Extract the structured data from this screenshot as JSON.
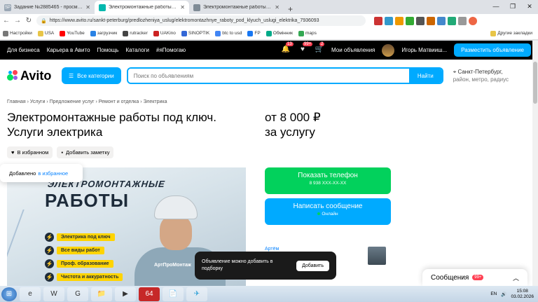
{
  "browser": {
    "tabs": [
      {
        "label": "Задание №2885465 - просмотр з",
        "favicon_color": "#9aa7b5",
        "favicon_text": "SP",
        "active": false
      },
      {
        "label": "Электромонтажные работы под",
        "favicon_color": "#04b8ae",
        "active": true
      },
      {
        "label": "Электромонтажные работы под",
        "favicon_color": "#7f8b96",
        "active": false
      }
    ],
    "new_tab": "+",
    "window_controls": [
      "—",
      "❐",
      "✕"
    ],
    "url": "https://www.avito.ru/sankt-peterburg/predlozheniya_uslug/elektromontazhnye_raboty_pod_klyuch_uslugi_elektrika_7936093",
    "bookmarks": [
      "Настройки",
      "USA",
      "YouTube",
      "загрузчик",
      "rutracker",
      "UAKino",
      "SINOPTIK",
      "btc to usd",
      "FP",
      "Обмінник",
      "maps",
      "Другие закладки"
    ]
  },
  "avito": {
    "topnav": [
      "Для бизнеса",
      "Карьера в Авито",
      "Помощь",
      "Каталоги",
      "#яПомогаю"
    ],
    "badges": {
      "notifications": "13",
      "favorites": "99+",
      "cart": "2"
    },
    "my_ads": "Мои объявления",
    "user_name": "Игорь Матвииш...",
    "post_ad": "Разместить объявление",
    "logo_text": "Avito",
    "categories_btn": "Все категории",
    "search_placeholder": "Поиск по объявлениям",
    "search_btn": "Найти",
    "location": "Санкт-Петербург,",
    "location_sub": "район, метро, радиус",
    "breadcrumbs": "Главная  ›  Услуги  ›  Предложение услуг  ›  Ремонт и отделка  ›  Электрика",
    "title": "Электромонтажные работы под ключ. Услуги электрика",
    "price_line1": "от 8 000 ₽",
    "price_line2": "за услугу",
    "favorite_btn": "В избранном",
    "note_btn": "Добавить заметку",
    "toast_added": "Добавлено",
    "toast_added_link": "в избранное",
    "photo": {
      "headline1": "ЭЛЕКТРОМОНТАЖНЫЕ",
      "headline2": "РАБОТЫ",
      "shirt_text": "АртПроМонтаж",
      "bullets": [
        "Электрика под ключ",
        "Все виды работ",
        "Проф. образование",
        "Чистота и аккуратность"
      ]
    },
    "call_btn": "Показать телефон",
    "call_phone": "8 938 XXX-XX-XX",
    "msg_btn": "Написать сообщение",
    "msg_status": "Онлайн",
    "seller_link": "Артём",
    "toast_save": "Объявление можно добавить в подборку",
    "toast_save_btn": "Добавить",
    "messages_label": "Сообщения",
    "messages_badge": "99+"
  },
  "taskbar": {
    "lang": "EN",
    "time": "15:08",
    "date": "03.02.2026",
    "apps": [
      "e",
      "W",
      "G",
      "📁",
      "▶",
      "64",
      "📄",
      "✈"
    ]
  }
}
